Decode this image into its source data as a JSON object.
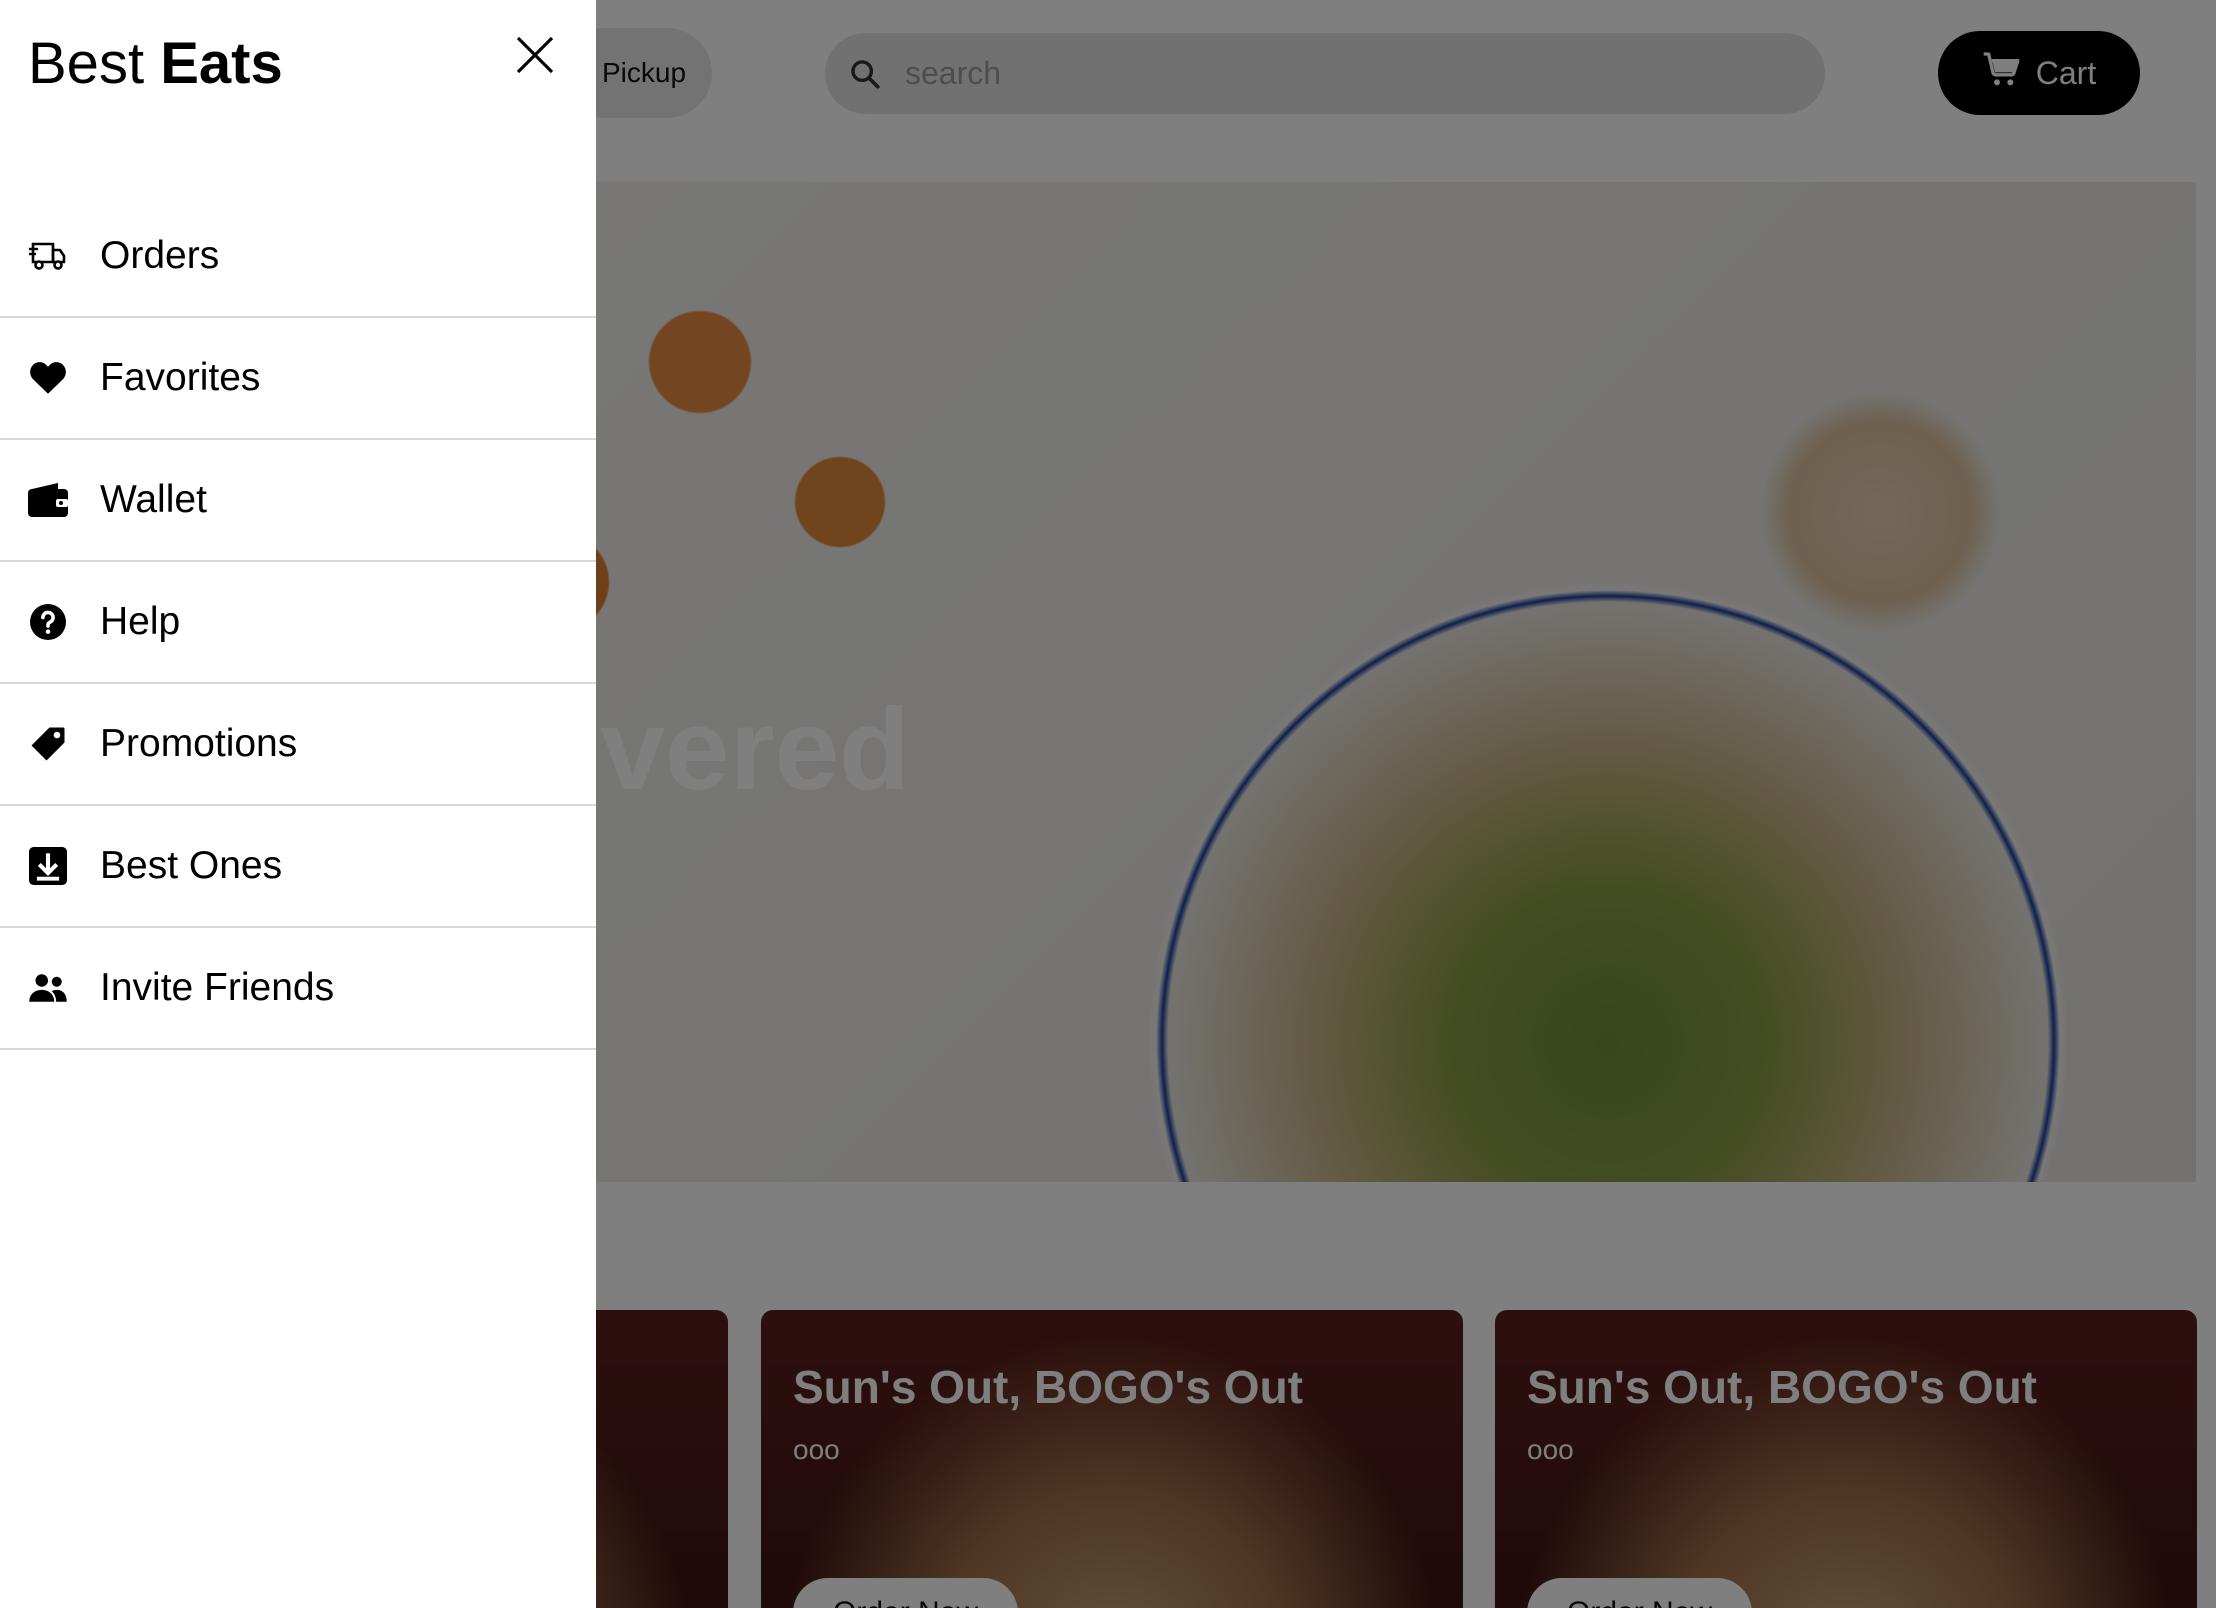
{
  "header": {
    "pickup_label": "Pickup",
    "search_placeholder": "search",
    "cart_label": "Cart"
  },
  "hero": {
    "title_visible": "vered"
  },
  "promos": [
    {
      "title": "Sun's Out, BOGO's Out",
      "subtitle": "ooo",
      "button": "Order Now"
    },
    {
      "title": "Sun's Out, BOGO's Out",
      "subtitle": "ooo",
      "button": "Order Now"
    }
  ],
  "drawer": {
    "brand_regular": "Best",
    "brand_bold": "Eats",
    "items": [
      {
        "label": "Orders",
        "icon": "truck-icon"
      },
      {
        "label": "Favorites",
        "icon": "heart-icon"
      },
      {
        "label": "Wallet",
        "icon": "wallet-icon"
      },
      {
        "label": "Help",
        "icon": "help-circle-icon"
      },
      {
        "label": "Promotions",
        "icon": "tag-icon"
      },
      {
        "label": "Best Ones",
        "icon": "download-box-icon"
      },
      {
        "label": "Invite Friends",
        "icon": "users-icon"
      }
    ]
  },
  "colors": {
    "drawer_bg": "#ffffff",
    "overlay": "rgba(0,0,0,0.5)",
    "cart_bg": "#000000",
    "divider": "#d8d8d8"
  }
}
